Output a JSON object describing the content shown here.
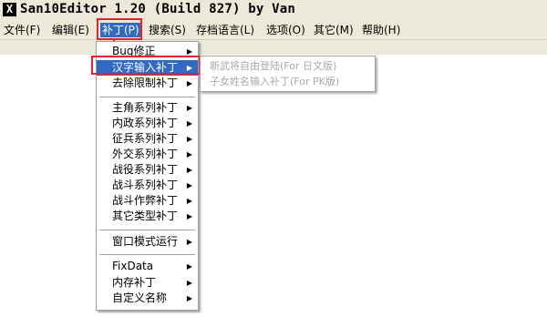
{
  "window": {
    "title": "San10Editor 1.20 (Build 827) by Van",
    "icon_glyph": "X"
  },
  "menubar": {
    "items": [
      {
        "label": "文件(F)"
      },
      {
        "label": "编辑(E)"
      },
      {
        "label": "补丁(P)"
      },
      {
        "label": "搜索(S)"
      },
      {
        "label": "存档语言(L)"
      },
      {
        "label": "选项(O)"
      },
      {
        "label": "其它(M)"
      },
      {
        "label": "帮助(H)"
      }
    ]
  },
  "patch_menu": {
    "items": [
      {
        "label": "Bug修正"
      },
      {
        "label": "汉字输入补丁"
      },
      {
        "label": "去除限制补丁"
      },
      {
        "label": "主角系列补丁"
      },
      {
        "label": "内政系列补丁"
      },
      {
        "label": "征兵系列补丁"
      },
      {
        "label": "外交系列补丁"
      },
      {
        "label": "战役系列补丁"
      },
      {
        "label": "战斗系列补丁"
      },
      {
        "label": "战斗作弊补丁"
      },
      {
        "label": "其它类型补丁"
      },
      {
        "label": "窗口模式运行"
      },
      {
        "label": "FixData"
      },
      {
        "label": "内存补丁"
      },
      {
        "label": "自定义名称"
      }
    ]
  },
  "submenu": {
    "items": [
      {
        "label": "新武将自由登陆(For 日文版)"
      },
      {
        "label": "子女姓名输入补丁(For PK版)"
      }
    ]
  },
  "colors": {
    "highlight": "#316ac5",
    "annotation": "#e8212b",
    "menubar_bg": "#ece9d8"
  }
}
